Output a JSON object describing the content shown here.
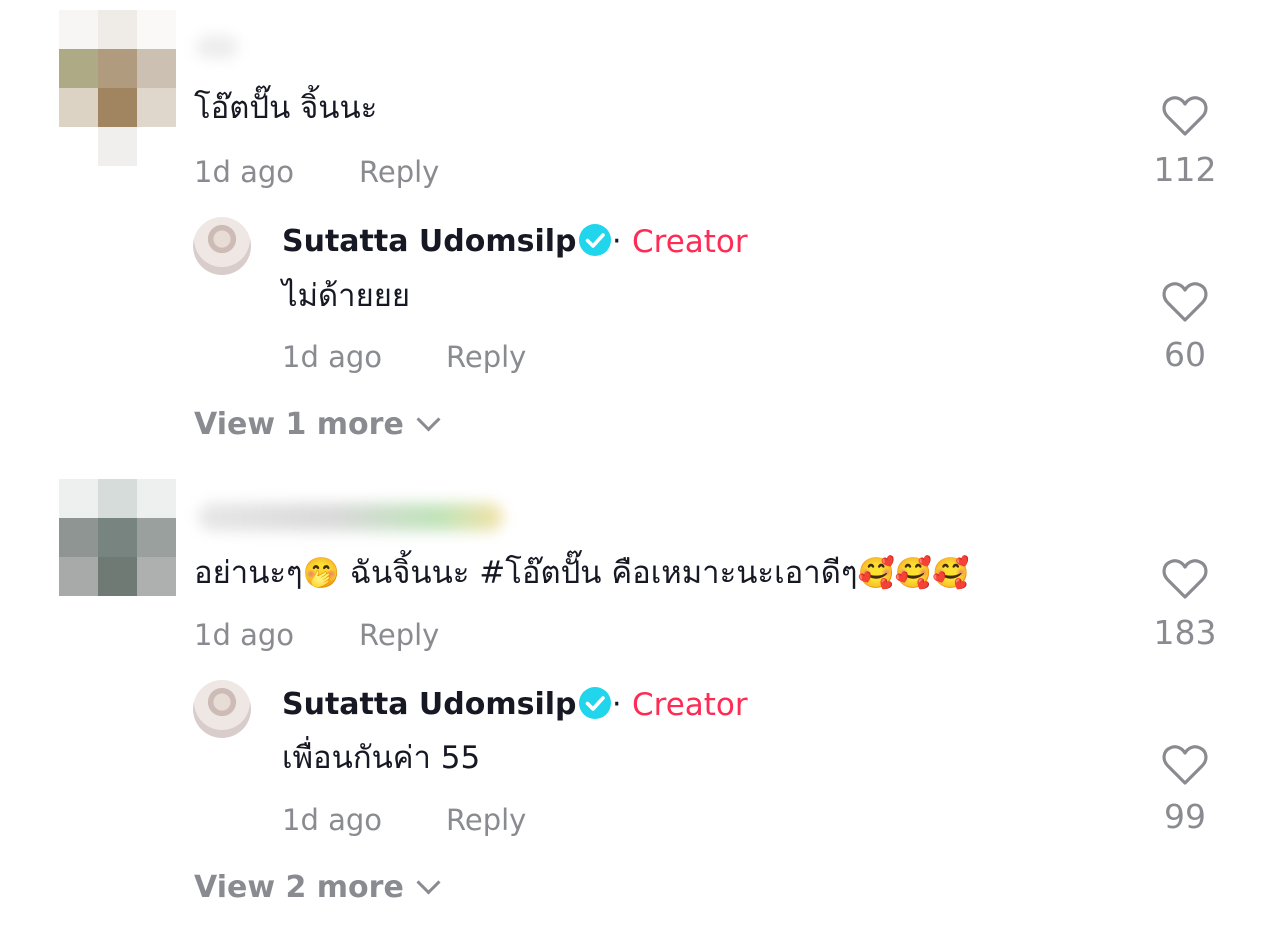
{
  "comments": [
    {
      "text": "โอ๊ตปั๊น จิ้นนะ",
      "time": "1d ago",
      "reply_label": "Reply",
      "likes": "112",
      "reply": {
        "author": "Sutatta Udomsilp",
        "badge": "Creator",
        "separator": "·",
        "text": "ไม่ด้ายยย",
        "time": "1d ago",
        "reply_label": "Reply",
        "likes": "60"
      },
      "view_more": "View 1 more"
    },
    {
      "text_prefix": "อย่านะๆ",
      "emoji_1": "🤭",
      "text_middle": " ฉันจิ้นนะ #โอ๊ตปั๊น คือเหมาะนะเอาดีๆ",
      "emoji_2": "🥰🥰🥰",
      "time": "1d ago",
      "reply_label": "Reply",
      "likes": "183",
      "reply": {
        "author": "Sutatta Udomsilp",
        "badge": "Creator",
        "separator": "·",
        "text": "เพื่อนกันค่า 55",
        "time": "1d ago",
        "reply_label": "Reply",
        "likes": "99"
      },
      "view_more": "View 2 more"
    }
  ],
  "colors": {
    "text": "#161823",
    "muted": "#8a8b91",
    "creator": "#fe2c55",
    "verified": "#20d5ec"
  },
  "icons": {
    "like": "heart-outline-icon",
    "verified": "verified-check-icon",
    "expand": "chevron-down-icon"
  }
}
